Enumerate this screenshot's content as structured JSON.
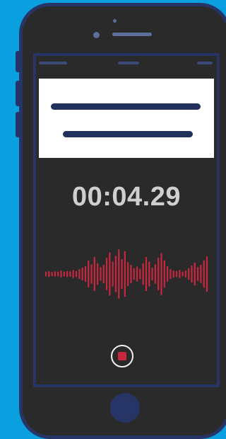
{
  "recorder": {
    "elapsed_time": "00:04.29",
    "waveform_levels": [
      0.06,
      0.08,
      0.05,
      0.07,
      0.06,
      0.1,
      0.06,
      0.08,
      0.07,
      0.12,
      0.08,
      0.15,
      0.2,
      0.25,
      0.45,
      0.32,
      0.58,
      0.36,
      0.22,
      0.3,
      0.55,
      0.74,
      0.42,
      0.62,
      0.84,
      0.5,
      0.78,
      0.4,
      0.3,
      0.18,
      0.24,
      0.16,
      0.36,
      0.58,
      0.42,
      0.2,
      0.32,
      0.55,
      0.72,
      0.46,
      0.25,
      0.15,
      0.1,
      0.08,
      0.12,
      0.06,
      0.1,
      0.18,
      0.28,
      0.38,
      0.22,
      0.3,
      0.46,
      0.6
    ],
    "waveform_color": "#c9273f",
    "stop_button_color": "#c9273f"
  },
  "colors": {
    "background": "#0aa0e0",
    "phone_frame": "#263566",
    "screen": "#2a2a2a"
  },
  "icons": {
    "stop": "stop-icon"
  }
}
